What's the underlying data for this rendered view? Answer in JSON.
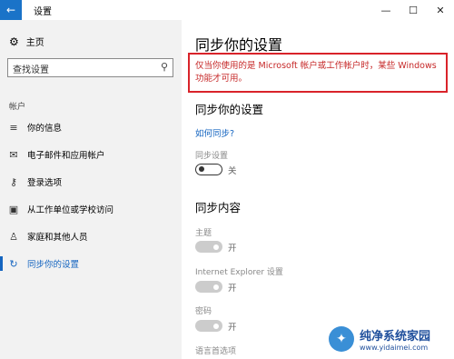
{
  "window": {
    "title": "设置",
    "back_glyph": "←",
    "minimize_glyph": "—",
    "maximize_glyph": "☐",
    "close_glyph": "✕"
  },
  "sidebar": {
    "home_label": "主页",
    "search_placeholder": "查找设置",
    "section_label": "帐户",
    "items": [
      {
        "label": "你的信息",
        "icon": "person-card-icon",
        "glyph": "≡",
        "active": false
      },
      {
        "label": "电子邮件和应用帐户",
        "icon": "mail-icon",
        "glyph": "✉",
        "active": false
      },
      {
        "label": "登录选项",
        "icon": "key-icon",
        "glyph": "⚷",
        "active": false
      },
      {
        "label": "从工作单位或学校访问",
        "icon": "briefcase-icon",
        "glyph": "▣",
        "active": false
      },
      {
        "label": "家庭和其他人员",
        "icon": "person-icon",
        "glyph": "♙",
        "active": false
      },
      {
        "label": "同步你的设置",
        "icon": "sync-icon",
        "glyph": "↻",
        "active": true
      }
    ]
  },
  "main": {
    "title": "同步你的设置",
    "notice": "仅当你使用的是 Microsoft 帐户或工作帐户时，某些 Windows 功能才可用。",
    "sync_section_title": "同步你的设置",
    "how_link": "如何同步?",
    "sync_setting": {
      "label": "同步设置",
      "state": "关",
      "on": false
    },
    "content_title": "同步内容",
    "content_items": [
      {
        "label": "主题",
        "state": "开"
      },
      {
        "label": "Internet Explorer 设置",
        "state": "开"
      },
      {
        "label": "密码",
        "state": "开"
      },
      {
        "label": "语言首选项"
      }
    ]
  },
  "watermark": {
    "title": "纯净系统家园",
    "url": "www.yidaimei.com"
  },
  "colors": {
    "accent": "#1565c0",
    "titlebar_accent": "#1a73c8",
    "notice_red": "#d9232a",
    "sidebar_bg": "#f2f2f2"
  }
}
